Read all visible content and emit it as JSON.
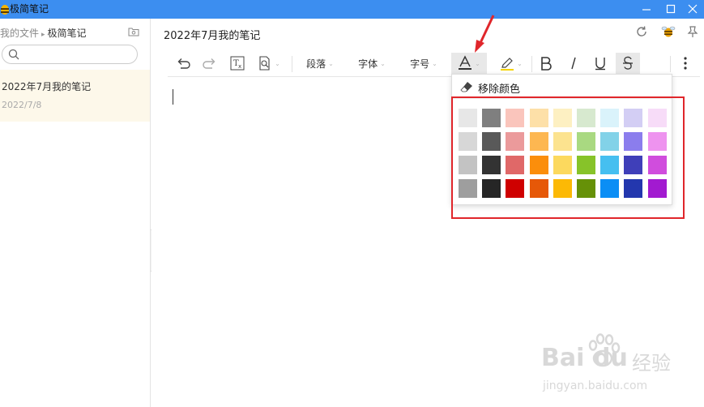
{
  "window": {
    "title": "极简笔记",
    "icon": "bee-app-icon"
  },
  "sidebar": {
    "breadcrumb": {
      "parent": "我的文件",
      "separator": "▸",
      "current": "极简笔记"
    },
    "search": {
      "placeholder": "",
      "value": ""
    },
    "notes": [
      {
        "title": "2022年7月我的笔记",
        "date": "2022/7/8"
      }
    ]
  },
  "editor": {
    "note_title": "2022年7月我的笔记",
    "toolbar": {
      "paragraph_label": "段落",
      "font_label": "字体",
      "size_label": "字号",
      "caret": "⌄"
    }
  },
  "color_popup": {
    "remove_label": "移除颜色",
    "swatches": [
      [
        "#e7e7e7",
        "#7f7f7f",
        "#fac5bc",
        "#fde0a8",
        "#fdf0c2",
        "#d7e9cf",
        "#daf3fb",
        "#d3cef4",
        "#f7dcf8"
      ],
      [
        "#d7d7d7",
        "#595959",
        "#eb9a9b",
        "#fdb751",
        "#fce38f",
        "#a9d981",
        "#82d2e8",
        "#8b7ded",
        "#ee93ef"
      ],
      [
        "#c3c3c3",
        "#333333",
        "#e06868",
        "#fb8e0b",
        "#fcd95e",
        "#87c329",
        "#46bff0",
        "#3f3fb9",
        "#d04ddd"
      ],
      [
        "#9e9e9e",
        "#262626",
        "#cf0000",
        "#e65808",
        "#fcb905",
        "#669108",
        "#0b8ef5",
        "#2337ae",
        "#a21ad0"
      ]
    ]
  },
  "watermark": {
    "brand": "Bai",
    "brand_suffix": "du",
    "cn": "经验",
    "url": "jingyan.baidu.com"
  },
  "colors": {
    "titlebar": "#3c8ef0",
    "note_selected_bg": "#fdf8ea",
    "highlight_border": "#e0262b",
    "arrow": "#e0262b"
  }
}
